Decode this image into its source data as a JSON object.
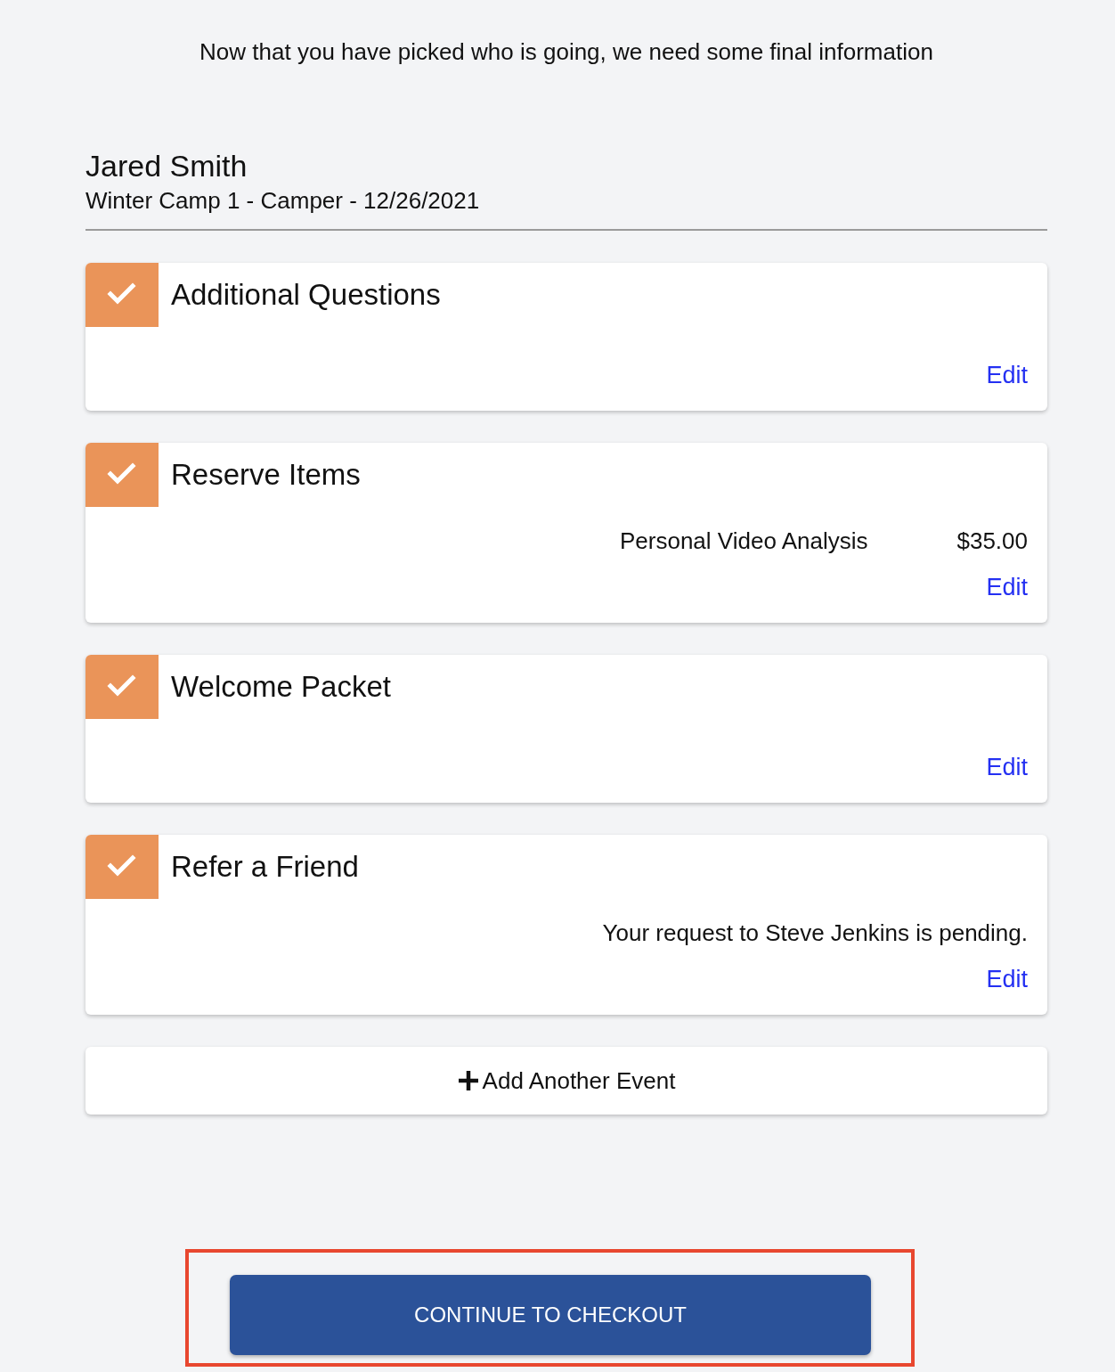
{
  "intro": "Now that you have picked who is going, we need some final information",
  "registrant": {
    "name": "Jared Smith",
    "event": "Winter Camp 1 - Camper - 12/26/2021"
  },
  "sections": [
    {
      "title": "Additional Questions",
      "completed": true,
      "edit": "Edit"
    },
    {
      "title": "Reserve Items",
      "completed": true,
      "items": [
        {
          "name": "Personal Video Analysis",
          "price": "$35.00"
        }
      ],
      "edit": "Edit"
    },
    {
      "title": "Welcome Packet",
      "completed": true,
      "edit": "Edit"
    },
    {
      "title": "Refer a Friend",
      "completed": true,
      "note": "Your request to Steve Jenkins is pending.",
      "edit": "Edit"
    }
  ],
  "add_event": {
    "label": "Add Another Event"
  },
  "checkout": {
    "label": "CONTINUE TO CHECKOUT",
    "highlighted": true
  }
}
